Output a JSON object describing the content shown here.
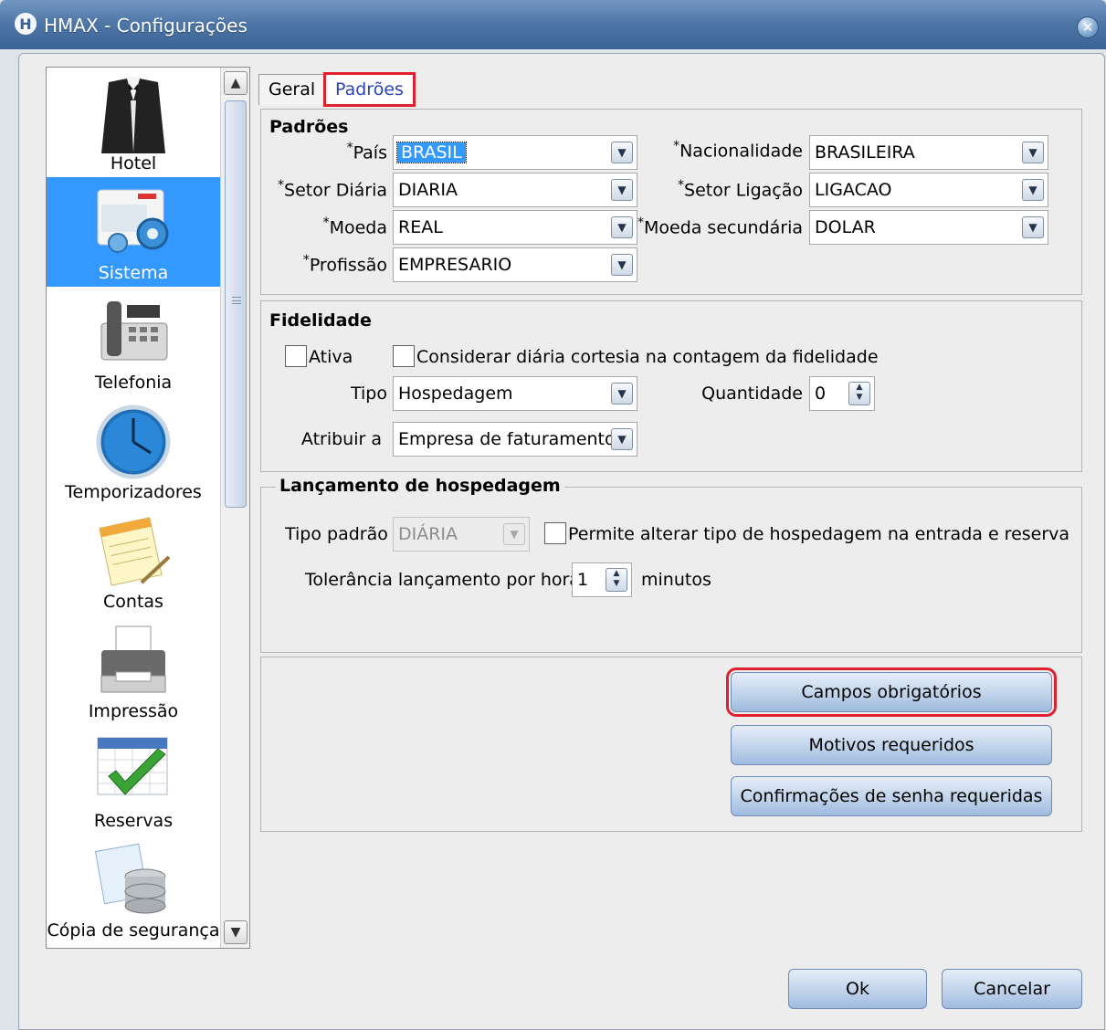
{
  "window": {
    "title": "HMAX - Configurações",
    "logo_glyph": "H"
  },
  "sidebar": {
    "items": [
      {
        "label": "Hotel",
        "icon": "tuxedo-icon"
      },
      {
        "label": "Sistema",
        "icon": "system-gear-icon",
        "selected": true
      },
      {
        "label": "Telefonia",
        "icon": "telephone-icon"
      },
      {
        "label": "Temporizadores",
        "icon": "clock-icon"
      },
      {
        "label": "Contas",
        "icon": "accounts-notepad-icon"
      },
      {
        "label": "Impressão",
        "icon": "printer-icon"
      },
      {
        "label": "Reservas",
        "icon": "calendar-check-icon"
      },
      {
        "label": "Cópia de segurança",
        "icon": "database-backup-icon"
      }
    ]
  },
  "tabs": [
    {
      "label": "Geral",
      "active": false
    },
    {
      "label": "Padrões",
      "active": true
    }
  ],
  "padroes": {
    "title": "Padrões",
    "required_mark": "*",
    "pais": {
      "label": "País",
      "value": "BRASIL"
    },
    "nacionalidade": {
      "label": "Nacionalidade",
      "value": "BRASILEIRA"
    },
    "setor_diaria": {
      "label": "Setor Diária",
      "value": "DIARIA"
    },
    "setor_ligacao": {
      "label": "Setor Ligação",
      "value": "LIGACAO"
    },
    "moeda": {
      "label": "Moeda",
      "value": "REAL"
    },
    "moeda_secundaria": {
      "label": "Moeda secundária",
      "value": "DOLAR"
    },
    "profissao": {
      "label": "Profissão",
      "value": "EMPRESARIO"
    }
  },
  "fidelidade": {
    "title": "Fidelidade",
    "ativa_label": "Ativa",
    "cortesia_label": "Considerar diária cortesia  na contagem da fidelidade",
    "tipo_label": "Tipo",
    "tipo_value": "Hospedagem",
    "quantidade_label": "Quantidade",
    "quantidade_value": "0",
    "atribuir_label": "Atribuir a",
    "atribuir_value": "Empresa de faturamento"
  },
  "lancamento": {
    "title": "Lançamento de hospedagem",
    "tipo_padrao_label": "Tipo padrão",
    "tipo_padrao_value": "DIÁRIA",
    "permite_label": "Permite alterar tipo de hospedagem na entrada e reserva",
    "tolerancia_label": "Tolerância lançamento por hora",
    "tolerancia_value": "1",
    "minutos_label": "minutos"
  },
  "actions": {
    "campos": "Campos obrigatórios",
    "motivos": "Motivos requeridos",
    "confirmacoes": "Confirmações de senha requeridas"
  },
  "footer": {
    "ok": "Ok",
    "cancel": "Cancelar"
  },
  "colors": {
    "accent": "#3399ff",
    "highlight": "#e0202e",
    "title_bar": "#4f77a7"
  }
}
